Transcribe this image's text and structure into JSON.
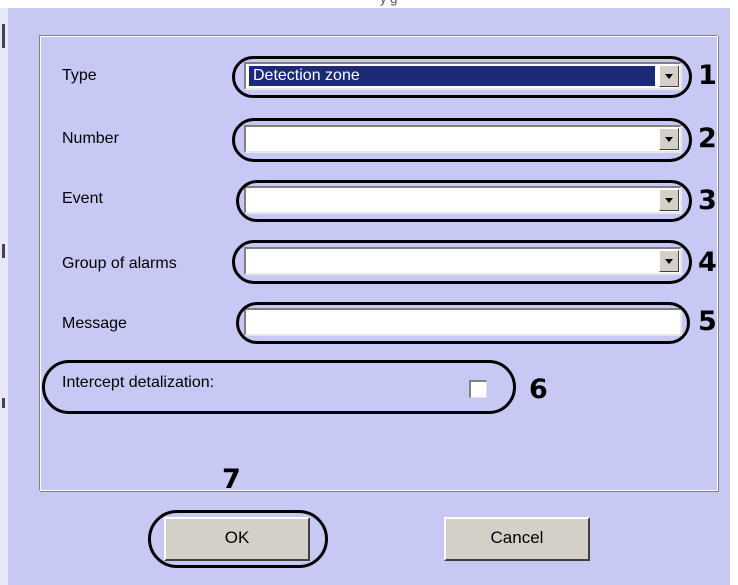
{
  "dialog": {
    "caption_fragment": "y                                          g"
  },
  "form": {
    "type": {
      "label": "Type",
      "value": "Detection zone"
    },
    "number": {
      "label": "Number",
      "value": ""
    },
    "event": {
      "label": "Event",
      "value": ""
    },
    "group": {
      "label": "Group of alarms",
      "value": ""
    },
    "message": {
      "label": "Message",
      "value": ""
    },
    "intercept": {
      "label": "Intercept detalization:",
      "checked": false
    }
  },
  "buttons": {
    "ok": "OK",
    "cancel": "Cancel"
  },
  "callouts": [
    "1",
    "2",
    "3",
    "4",
    "5",
    "6",
    "7"
  ],
  "colors": {
    "dialog_bg": "#c8c8f4",
    "selection": "#1c2a78",
    "button_face": "#d4d0c8"
  },
  "icons": {
    "dropdown": "chevron-down-icon",
    "checkbox": "checkbox-unchecked-icon"
  }
}
